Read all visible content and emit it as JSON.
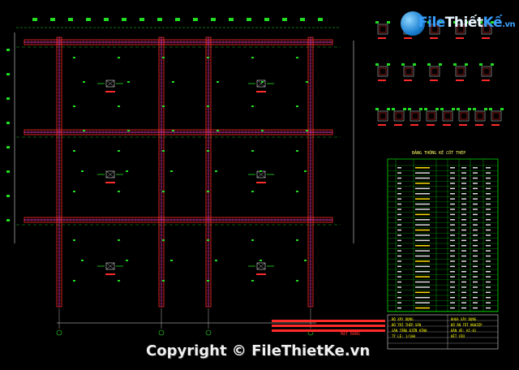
{
  "watermark": {
    "logo_file": "File",
    "logo_thiet": "Thiết",
    "logo_ke": "Kế",
    "logo_vn": ".vn",
    "copyright": "Copyright © FileThietKe.vn"
  },
  "drawing": {
    "table_title": "BẢNG THỐNG KÊ CỐT THÉP",
    "grid_bubbles": [
      "1",
      "2",
      "3",
      "4"
    ],
    "bottom_label": "MẶT BẰNG",
    "title_block": {
      "line1": "BỘ XÂY DỰNG",
      "line2": "BỐ TRÍ THÉP SÀN",
      "line3": "SÀN TẦNG ĐIỂN HÌNH",
      "line4": "TỶ LỆ: 1/100",
      "line5": "KHOA XÂY DỰNG",
      "line6": "ĐỒ ÁN TỐT NGHIỆP",
      "line7": "BẢN VẼ: KC-01",
      "line8": "KẾT CẤU"
    }
  },
  "colors": {
    "background": "#000000",
    "beam_red": "#ff2a2a",
    "frame_green": "#22dd22",
    "rebar_magenta": "#ff44ff",
    "dim_white": "#dddddd",
    "table_green": "#00cc00",
    "text_yellow": "#ffff33",
    "table_accent": "#ffdd00",
    "label_cyan": "#33ffff"
  }
}
